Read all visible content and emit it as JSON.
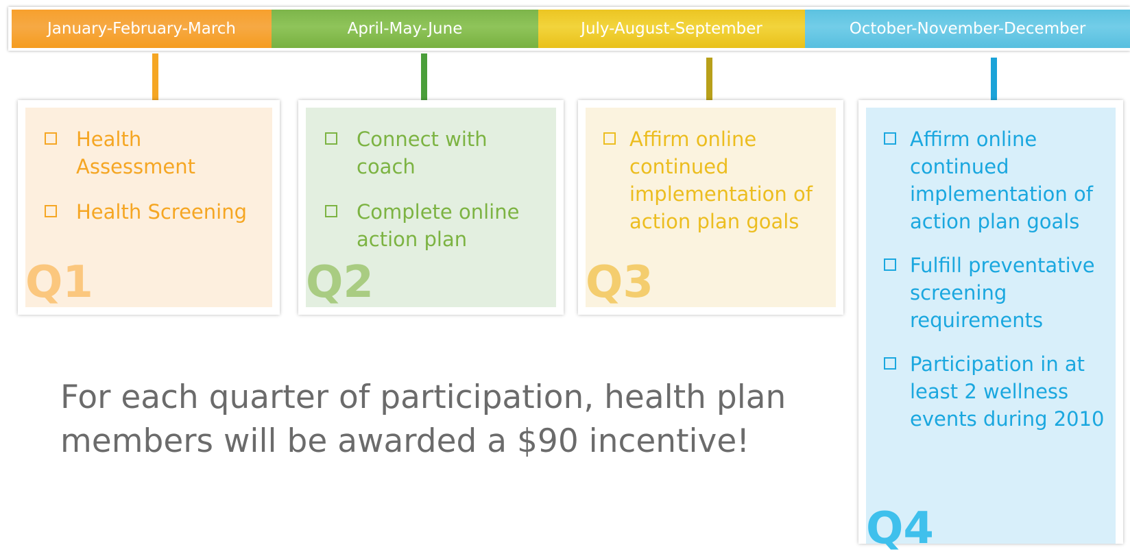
{
  "header": {
    "segments": [
      {
        "label": "January-February-March",
        "color": "#f6a22e"
      },
      {
        "label": "April-May-June",
        "color": "#85bc4f"
      },
      {
        "label": "July-August-September",
        "color": "#eec82a"
      },
      {
        "label": "October-November-December",
        "color": "#63c6e3"
      }
    ]
  },
  "quarters": [
    {
      "label": "Q1",
      "accent": "#f5a623",
      "tasks": [
        "Health Assessment",
        "Health Screening"
      ]
    },
    {
      "label": "Q2",
      "accent": "#7cb342",
      "tasks": [
        "Connect with coach",
        "Complete online action plan"
      ]
    },
    {
      "label": "Q3",
      "accent": "#ecbd1f",
      "tasks": [
        "Affirm online continued implementation of action plan goals"
      ]
    },
    {
      "label": "Q4",
      "accent": "#1aa7df",
      "tasks": [
        "Affirm online continued implementation of action plan goals",
        "Fulfill preventative screening requirements",
        "Participation in at least 2 wellness events during 2010"
      ]
    }
  ],
  "message": "For each quarter of participation, health plan members will be awarded a $90 incentive!",
  "icons": {
    "checkbox": "empty-checkbox-icon"
  }
}
